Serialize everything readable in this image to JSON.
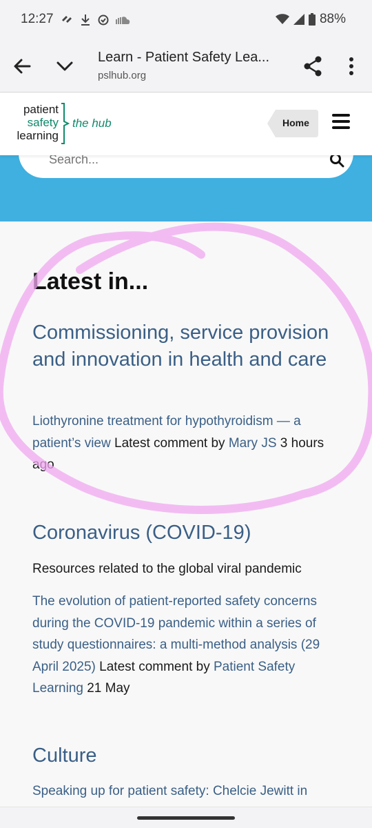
{
  "status": {
    "time": "12:27",
    "battery": "88%"
  },
  "browser": {
    "title": "Learn - Patient Safety Lea...",
    "url": "pslhub.org"
  },
  "site": {
    "logo_line1": "patient",
    "logo_line2": "safety",
    "logo_line3": "learning",
    "logo_hub": "the hub",
    "home_label": "Home",
    "search_placeholder": "Search..."
  },
  "main": {
    "heading": "Latest in...",
    "sections": [
      {
        "title": "Commissioning, service provision and innovation in health and care",
        "post_link": "Liothyronine treatment for hypothyroidism — a patient’s view",
        "latest_text": "Latest comment by",
        "author": "Mary JS",
        "time": "3 hours ago"
      },
      {
        "title": "Coronavirus (COVID-19)",
        "description": "Resources related to the global viral pandemic",
        "post_link": "The evolution of patient-reported safety concerns during the COVID-19 pandemic within a series of study questionnaires: a multi-method analysis (29 April 2025)",
        "latest_text": "Latest comment by",
        "author": "Patient Safety Learning",
        "time": "21 May"
      },
      {
        "title": "Culture",
        "post_link": "Speaking up for patient safety: Chelcie Jewitt in"
      }
    ]
  },
  "colors": {
    "brand_green": "#0e8a6b",
    "band_blue": "#3fb0e0",
    "link_blue": "#3a5f86",
    "annotation_pink": "#f0a8f0"
  }
}
